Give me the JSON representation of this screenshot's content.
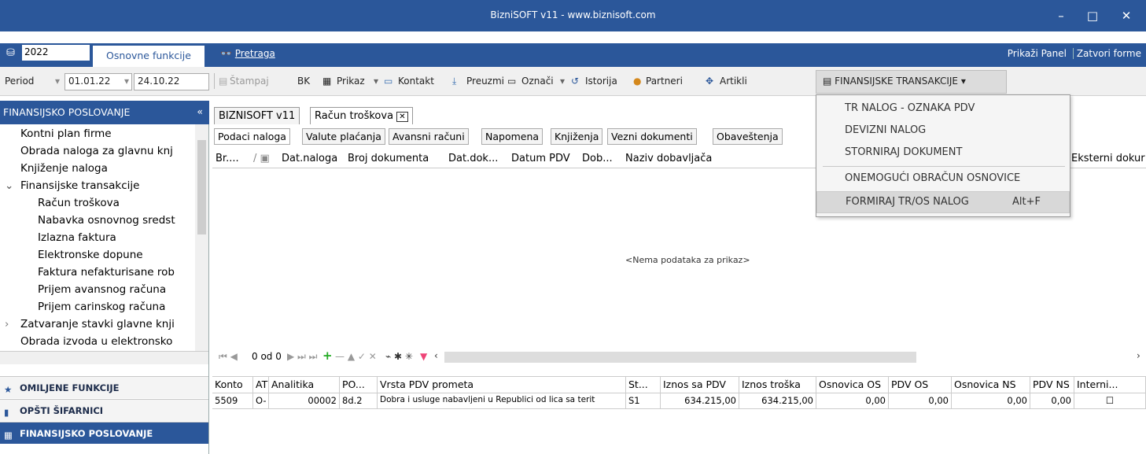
{
  "window": {
    "title": "BizniSOFT v11 - www.biznisoft.com",
    "minimize": "–",
    "maximize": "□",
    "close": "✕"
  },
  "top": {
    "year": "2022",
    "tab": "Osnovne funkcije",
    "search_icon": "binoculars-icon",
    "search_prefix": "",
    "search": "Pretraga",
    "show_panel": "Prikaži Panel",
    "close_forms": "Zatvori forme"
  },
  "toolbar": {
    "period": "Period",
    "date_from": "01.01.22",
    "date_to": "24.10.22",
    "print": "Štampaj",
    "bk": "BK",
    "view": "Prikaz",
    "contact": "Kontakt",
    "download": "Preuzmi",
    "mark": "Označi",
    "history": "Istorija",
    "partners": "Partneri",
    "items": "Artikli",
    "fin": "FINANSIJSKE TRANSAKCIJE"
  },
  "sidebar": {
    "header": "FINANSIJSKO POSLOVANJE",
    "collapse": "«",
    "items": [
      "Kontni plan firme",
      "Obrada naloga za glavnu knj",
      "Knjiženje naloga",
      "Finansijske transakcije",
      "Račun troškova",
      "Nabavka osnovnog sredst",
      "Izlazna faktura",
      "Elektronske dopune",
      "Faktura nefakturisane rob",
      "Prijem avansnog računa",
      "Prijem carinskog računa",
      "Zatvaranje stavki glavne knji",
      "Obrada izvoda u elektronsko"
    ],
    "bars": [
      "OMILJENE FUNKCIJE",
      "OPŠTI ŠIFARNICI",
      "FINANSIJSKO POSLOVANJE"
    ]
  },
  "doc_tabs": [
    "BIZNISOFT v11",
    "Račun troškova"
  ],
  "sub_tabs": [
    "Podaci naloga",
    "Valute plaćanja",
    "Avansni računi",
    "Napomena",
    "Knjiženja",
    "Vezni dokumenti",
    "Obaveštenja"
  ],
  "grid1": {
    "columns": [
      "Br....",
      "Dat.naloga",
      "Broj dokumenta",
      "Dat.dok...",
      "Datum PDV",
      "Dob...",
      "Naziv dobavljača",
      "Eksterni dokur"
    ],
    "empty": "<Nema podataka za prikaz>"
  },
  "nav": {
    "counter": "0 od 0"
  },
  "grid2": {
    "columns": [
      "Konto",
      "AT",
      "Analitika",
      "PO...",
      "Vrsta PDV prometa",
      "St...",
      "Iznos sa PDV",
      "Iznos troška",
      "Osnovica OS",
      "PDV OS",
      "Osnovica NS",
      "PDV NS",
      "Interni..."
    ],
    "row": [
      "5509",
      "O-",
      "00002",
      "8d.2",
      "Dobra i usluge nabavljeni u Republici od lica sa terit",
      "S1",
      "634.215,00",
      "634.215,00",
      "0,00",
      "0,00",
      "0,00",
      "0,00",
      "☐"
    ]
  },
  "menu": {
    "items": [
      "TR NALOG - OZNAKA PDV",
      "DEVIZNI NALOG",
      "STORNIRAJ DOKUMENT",
      "ONEMOGUĆI OBRAČUN OSNOVICE",
      "FORMIRAJ TR/OS NALOG"
    ],
    "shortcut": "Alt+F"
  },
  "colors": {
    "accent": "#2b579a"
  }
}
